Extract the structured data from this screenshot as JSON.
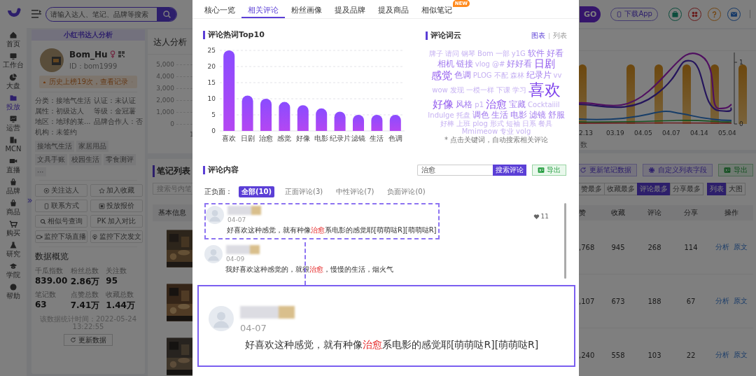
{
  "topbar": {
    "search_placeholder": "请输入达人、笔记、品牌等搜索",
    "go_badge": "GO",
    "download_button": "下载App"
  },
  "nav": {
    "items": [
      {
        "label": "首页",
        "selected": false
      },
      {
        "label": "工作台",
        "selected": false
      },
      {
        "label": "大盘",
        "selected": false
      },
      {
        "label": "投放",
        "selected": true
      },
      {
        "label": "运营",
        "selected": false
      },
      {
        "label": "MCN",
        "selected": false
      },
      {
        "label": "直播",
        "selected": false
      },
      {
        "label": "品牌",
        "selected": false
      },
      {
        "label": "商品",
        "selected": false
      },
      {
        "label": "购买",
        "selected": false
      },
      {
        "label": "研究",
        "selected": false
      },
      {
        "label": "学院",
        "selected": false
      },
      {
        "label": "帮助",
        "selected": false
      }
    ]
  },
  "profile": {
    "header": "小红书达人分析",
    "name": "Bom_Hu",
    "id": "ID：bom1999",
    "history": "历史上榜19次，查看记录",
    "info": [
      "分类：接地气生活",
      "认证：未认证",
      "属性：初级达人",
      "等级：金冠薯",
      "地区：地球的某...",
      "品牌合作人：否",
      "机构：未签约"
    ],
    "tags": [
      "接地气生活",
      "家居用品",
      "文具手账",
      "校园生活",
      "零食测评",
      "···"
    ],
    "actions": [
      "关注达人",
      "加入收藏",
      "联系方式",
      "投放报价",
      "相似号查询",
      "PK 加入对比",
      "监控下场直播",
      "监控下次发文"
    ],
    "overview_title": "数据概览",
    "stats": [
      {
        "label": "千瓜指数",
        "value": "839.00"
      },
      {
        "label": "粉丝总数",
        "value": "2.86万"
      },
      {
        "label": "关注数",
        "value": "95"
      },
      {
        "label": "笔记数",
        "value": "63"
      },
      {
        "label": "点赞总数",
        "value": "7.41万"
      },
      {
        "label": "收藏总数",
        "value": "1.44万"
      }
    ],
    "timestamp": "该数据统计时间：2022-05-24 13:22:55",
    "refresh_button": "更新数据"
  },
  "analysis": {
    "title": "达人分析",
    "left_ticks": [
      "5,000",
      "4,000",
      "3,000",
      "2,000",
      "1,000",
      "0"
    ],
    "x_fragment": "1",
    "right_ticks": [
      "1",
      "0"
    ],
    "x_labels": [
      "2.13",
      "03.19",
      "04.05",
      "04.07",
      "04.14",
      "05.04"
    ],
    "legend_fragment": "数"
  },
  "notes": {
    "title": "笔记列表",
    "search_placeholder": "搜索号内笔",
    "tools": [
      "更新笔记数据",
      "自定义列表字段",
      "导出"
    ],
    "sorts": [
      {
        "label": "赞最多",
        "selected": false
      },
      {
        "label": "收藏最多",
        "selected": false
      },
      {
        "label": "评论最多",
        "selected": true
      },
      {
        "label": "分享最多",
        "selected": false
      }
    ],
    "views": [
      {
        "label": "列表",
        "selected": true
      },
      {
        "label": "大图",
        "selected": false
      }
    ],
    "first_column": "基本信息",
    "columns": [
      "赞",
      "收藏",
      "评论",
      "分享",
      "操作"
    ],
    "rows": [
      {
        "thumbnail": {
          "kind": "picture"
        },
        "cells": [
          ",768",
          "945",
          "268",
          "114"
        ],
        "actions": [
          "分析",
          "原文"
        ]
      },
      {
        "thumbnail": {
          "kind": "picture"
        },
        "cells": [
          ",107",
          "673",
          "188",
          "67"
        ],
        "actions": [
          "分析",
          "原文"
        ]
      },
      {
        "thumbnail": {
          "kind": "picture"
        },
        "cells": [
          ",240",
          "558",
          "103",
          "22"
        ],
        "actions": [
          "分析",
          "原文"
        ]
      }
    ]
  },
  "modal": {
    "tabs": [
      {
        "label": "核心一览",
        "selected": false
      },
      {
        "label": "相关评论",
        "selected": true
      },
      {
        "label": "粉丝画像",
        "selected": false
      },
      {
        "label": "提及品牌",
        "selected": false
      },
      {
        "label": "提及商品",
        "selected": false
      },
      {
        "label": "相似笔记",
        "selected": false,
        "badge": "NEW"
      }
    ],
    "hotwords": {
      "title": "评论热词Top10",
      "chart_data": {
        "type": "bar",
        "categories": [
          "喜欢",
          "日剧",
          "治愈",
          "感觉",
          "好像",
          "电影",
          "纪录片",
          "滤镜",
          "生活",
          "色调"
        ],
        "values": [
          25,
          11,
          10,
          9,
          8,
          7,
          6,
          5,
          5,
          5
        ],
        "grid": true,
        "ylim": [
          0,
          25
        ],
        "yticks": [
          0,
          5,
          10,
          15,
          20,
          25
        ]
      }
    },
    "cloud": {
      "title": "评论词云",
      "views": [
        {
          "label": "图表",
          "selected": true
        },
        {
          "label": "列表",
          "selected": false
        }
      ],
      "words": [
        {
          "text": "牌子",
          "kind": "small"
        },
        {
          "text": "请问",
          "kind": "small"
        },
        {
          "text": "钢琴",
          "kind": "small"
        },
        {
          "text": "Bom",
          "kind": "small"
        },
        {
          "text": "一部",
          "kind": "small"
        },
        {
          "text": "y1G",
          "kind": "small"
        },
        {
          "text": "软件",
          "kind": "medium"
        },
        {
          "text": "好看",
          "kind": "medium"
        },
        {
          "text": "相机",
          "kind": "medium"
        },
        {
          "text": "链接",
          "kind": "medium"
        },
        {
          "text": "vlog",
          "kind": "small"
        },
        {
          "text": "@#",
          "kind": "small"
        },
        {
          "text": "好好看",
          "kind": "medium"
        },
        {
          "text": "日剧",
          "kind": "big"
        },
        {
          "text": "感觉",
          "kind": "big"
        },
        {
          "text": "色调",
          "kind": "medium"
        },
        {
          "text": "PLOG",
          "kind": "small"
        },
        {
          "text": "不配",
          "kind": "small"
        },
        {
          "text": "森林",
          "kind": "small"
        },
        {
          "text": "纪录片",
          "kind": "medium"
        },
        {
          "text": "vv",
          "kind": "small"
        },
        {
          "text": "wow",
          "kind": "small"
        },
        {
          "text": "发现",
          "kind": "small"
        },
        {
          "text": "一模一样",
          "kind": "small"
        },
        {
          "text": "下课",
          "kind": "small"
        },
        {
          "text": "学习",
          "kind": "small"
        },
        {
          "text": "喜欢",
          "kind": "large"
        },
        {
          "text": "好像",
          "kind": "big"
        },
        {
          "text": "风格",
          "kind": "medium"
        },
        {
          "text": "p1",
          "kind": "small"
        },
        {
          "text": "治愈",
          "kind": "big"
        },
        {
          "text": "宝藏",
          "kind": "medium"
        },
        {
          "text": "Cocktaiiil",
          "kind": "small"
        },
        {
          "text": "Indulge",
          "kind": "small"
        },
        {
          "text": "托盘",
          "kind": "small"
        },
        {
          "text": "调色",
          "kind": "medium"
        },
        {
          "text": "生活",
          "kind": "medium"
        },
        {
          "text": "电影",
          "kind": "medium"
        },
        {
          "text": "滤镜",
          "kind": "medium"
        },
        {
          "text": "舒服",
          "kind": "medium"
        },
        {
          "text": "好棒",
          "kind": "small"
        },
        {
          "text": "上班",
          "kind": "small"
        },
        {
          "text": "plog",
          "kind": "small"
        },
        {
          "text": "形式",
          "kind": "small"
        },
        {
          "text": "短袖",
          "kind": "small"
        },
        {
          "text": "日系",
          "kind": "small"
        },
        {
          "text": "餐具",
          "kind": "small"
        },
        {
          "text": "Mmimeow",
          "kind": "small"
        },
        {
          "text": "专业",
          "kind": "small"
        },
        {
          "text": "volg",
          "kind": "small"
        }
      ],
      "note": "* 点击关键词，自动搜索相关评论"
    },
    "comments": {
      "title": "评论内容",
      "search_value": "治愈",
      "search_button": "搜索评论",
      "export_button": "导出",
      "filter_label": "正负面：",
      "filters": [
        {
          "label": "全部(10)",
          "selected": true
        },
        {
          "label": "正面评论(3)",
          "selected": false
        },
        {
          "label": "中性评论(7)",
          "selected": false
        },
        {
          "label": "负面评论(0)",
          "selected": false
        }
      ],
      "items": [
        {
          "date": "04-07",
          "likes": "11",
          "highlighted": true,
          "parts": [
            {
              "text": "好喜欢这种感觉，就有种像",
              "match": false
            },
            {
              "text": "治愈",
              "match": true
            },
            {
              "text": "系电影的感觉耶[萌萌哒R][萌萌哒R]",
              "match": false
            }
          ]
        },
        {
          "date": "04-09",
          "highlighted": false,
          "parts": [
            {
              "text": "我好喜欢这种感觉的，就很",
              "match": false
            },
            {
              "text": "治愈",
              "match": true
            },
            {
              "text": "，慢慢的生活，烟火气",
              "match": false
            }
          ]
        }
      ]
    },
    "callout": {
      "date": "04-07",
      "parts": [
        {
          "text": "好喜欢这种感觉，就有种像",
          "match": false
        },
        {
          "text": "治愈",
          "match": true
        },
        {
          "text": "系电影的感觉耶[萌萌哒R][萌萌哒R]",
          "match": false
        }
      ]
    }
  }
}
